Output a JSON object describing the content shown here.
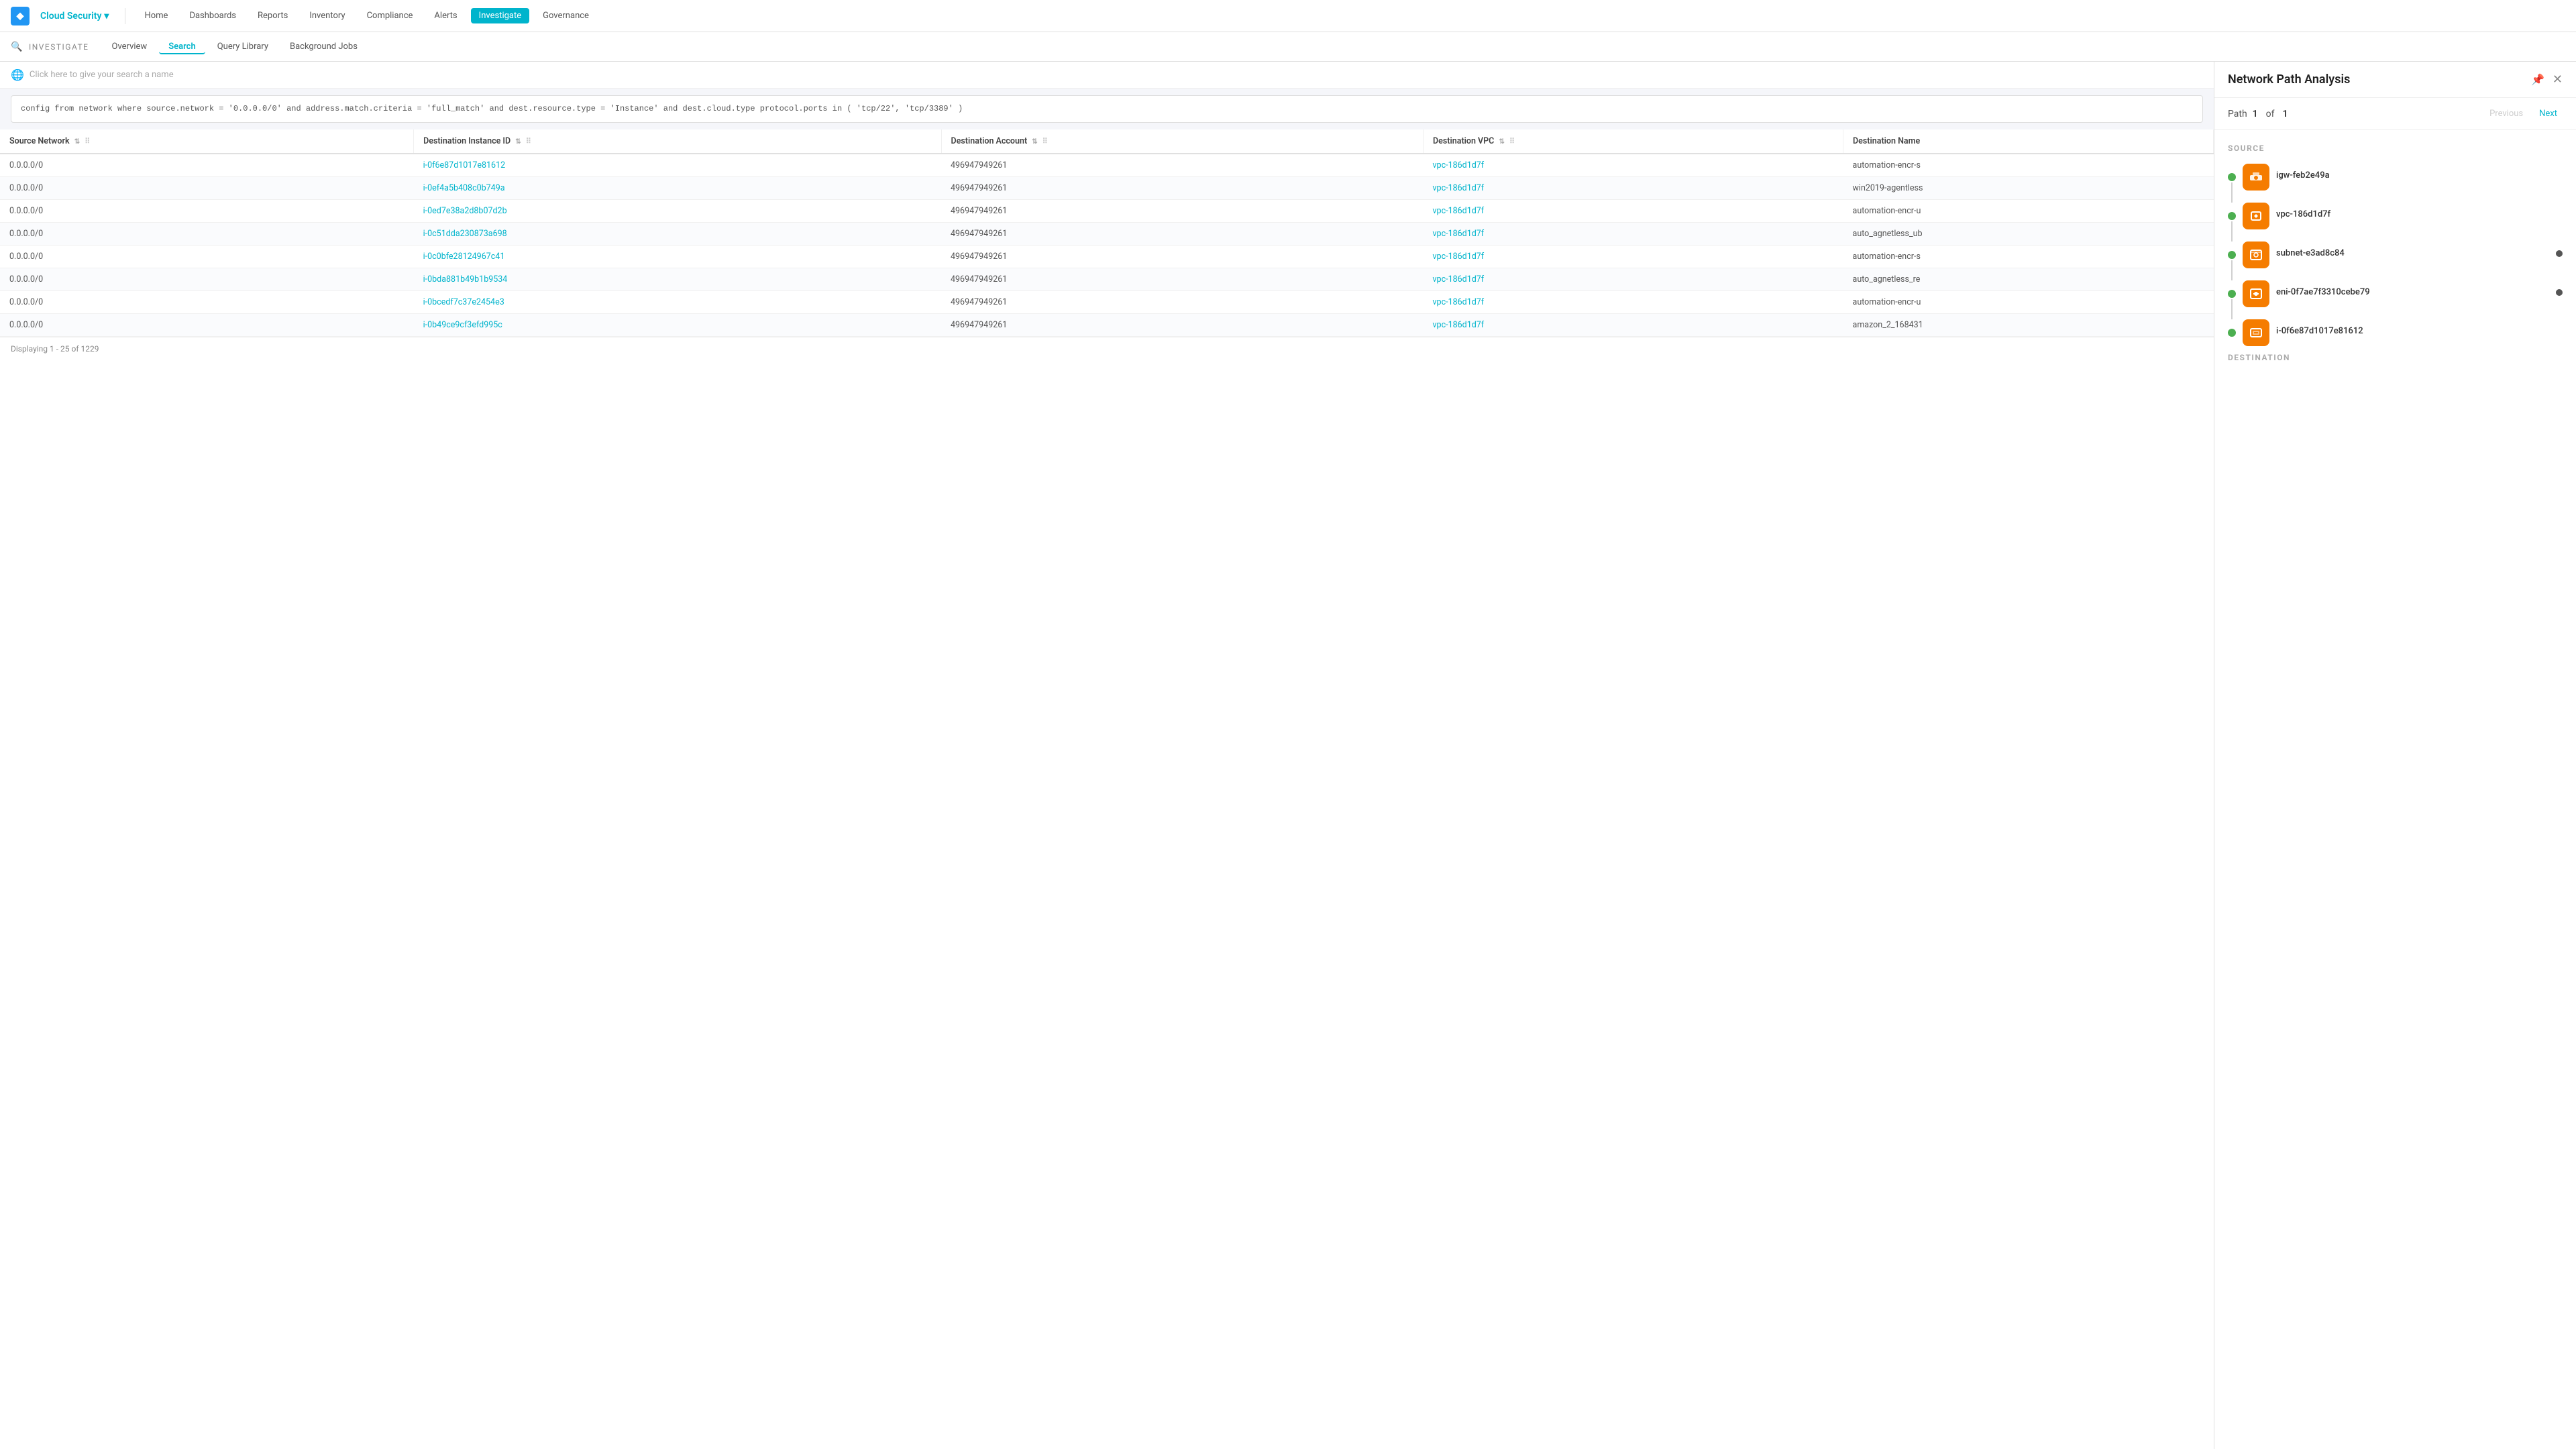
{
  "app": {
    "logo": "◆",
    "brand": "Cloud Security",
    "brand_arrow": "▾"
  },
  "top_nav": {
    "items": [
      {
        "label": "Home",
        "active": false
      },
      {
        "label": "Dashboards",
        "active": false
      },
      {
        "label": "Reports",
        "active": false
      },
      {
        "label": "Inventory",
        "active": false
      },
      {
        "label": "Compliance",
        "active": false
      },
      {
        "label": "Alerts",
        "active": false
      },
      {
        "label": "Investigate",
        "active": true
      },
      {
        "label": "Governance",
        "active": false
      }
    ]
  },
  "sub_nav": {
    "investigate_label": "INVESTIGATE",
    "items": [
      {
        "label": "Overview",
        "active": false
      },
      {
        "label": "Search",
        "active": true
      },
      {
        "label": "Query Library",
        "active": false
      },
      {
        "label": "Background Jobs",
        "active": false
      }
    ]
  },
  "search_name": {
    "placeholder": "Click here to give your search a name",
    "globe_icon": "🌐"
  },
  "query": "config from network where source.network = '0.0.0.0/0' and address.match.criteria = 'full_match' and dest.resource.type = 'Instance' and dest.cloud.type\nprotocol.ports in ( 'tcp/22', 'tcp/3389' )",
  "table": {
    "columns": [
      {
        "label": "Source Network",
        "key": "source_network"
      },
      {
        "label": "Destination Instance ID",
        "key": "dest_instance_id"
      },
      {
        "label": "Destination Account",
        "key": "dest_account"
      },
      {
        "label": "Destination VPC",
        "key": "dest_vpc"
      },
      {
        "label": "Destination Name",
        "key": "dest_name"
      }
    ],
    "rows": [
      {
        "source_network": "0.0.0.0/0",
        "dest_instance_id": "i-0f6e87d1017e81612",
        "dest_account": "496947949261",
        "dest_vpc": "vpc-186d1d7f",
        "dest_name": "automation-encr-s"
      },
      {
        "source_network": "0.0.0.0/0",
        "dest_instance_id": "i-0ef4a5b408c0b749a",
        "dest_account": "496947949261",
        "dest_vpc": "vpc-186d1d7f",
        "dest_name": "win2019-agentless"
      },
      {
        "source_network": "0.0.0.0/0",
        "dest_instance_id": "i-0ed7e38a2d8b07d2b",
        "dest_account": "496947949261",
        "dest_vpc": "vpc-186d1d7f",
        "dest_name": "automation-encr-u"
      },
      {
        "source_network": "0.0.0.0/0",
        "dest_instance_id": "i-0c51dda230873a698",
        "dest_account": "496947949261",
        "dest_vpc": "vpc-186d1d7f",
        "dest_name": "auto_agnetless_ub"
      },
      {
        "source_network": "0.0.0.0/0",
        "dest_instance_id": "i-0c0bfe28124967c41",
        "dest_account": "496947949261",
        "dest_vpc": "vpc-186d1d7f",
        "dest_name": "automation-encr-s"
      },
      {
        "source_network": "0.0.0.0/0",
        "dest_instance_id": "i-0bda881b49b1b9534",
        "dest_account": "496947949261",
        "dest_vpc": "vpc-186d1d7f",
        "dest_name": "auto_agnetless_re"
      },
      {
        "source_network": "0.0.0.0/0",
        "dest_instance_id": "i-0bcedf7c37e2454e3",
        "dest_account": "496947949261",
        "dest_vpc": "vpc-186d1d7f",
        "dest_name": "automation-encr-u"
      },
      {
        "source_network": "0.0.0.0/0",
        "dest_instance_id": "i-0b49ce9cf3efd995c",
        "dest_account": "496947949261",
        "dest_vpc": "vpc-186d1d7f",
        "dest_name": "amazon_2_168431"
      }
    ],
    "footer": "Displaying 1 - 25 of 1229"
  },
  "right_panel": {
    "title": "Network Path Analysis",
    "pin_icon": "📌",
    "close_icon": "✕",
    "path_label": "Path",
    "path_current": "1",
    "path_of": "of",
    "path_total": "1",
    "prev_label": "Previous",
    "next_label": "Next",
    "source_section": "SOURCE",
    "destination_section": "DESTINATION",
    "nodes": [
      {
        "id": "igw-feb2e49a",
        "type": "igw",
        "icon": "🔶",
        "has_right_dot": false
      },
      {
        "id": "vpc-186d1d7f",
        "type": "vpc",
        "icon": "🔒",
        "has_right_dot": false
      },
      {
        "id": "subnet-e3ad8c84",
        "type": "subnet",
        "icon": "🔐",
        "has_right_dot": true
      },
      {
        "id": "eni-0f7ae7f3310cebe79",
        "type": "eni",
        "icon": "🔶",
        "has_right_dot": true
      },
      {
        "id": "i-0f6e87d1017e81612",
        "type": "instance",
        "icon": "🖥",
        "has_right_dot": false
      }
    ]
  },
  "colors": {
    "accent": "#00b4cc",
    "orange": "#f57c00",
    "green": "#4caf50",
    "link": "#00b4cc"
  }
}
